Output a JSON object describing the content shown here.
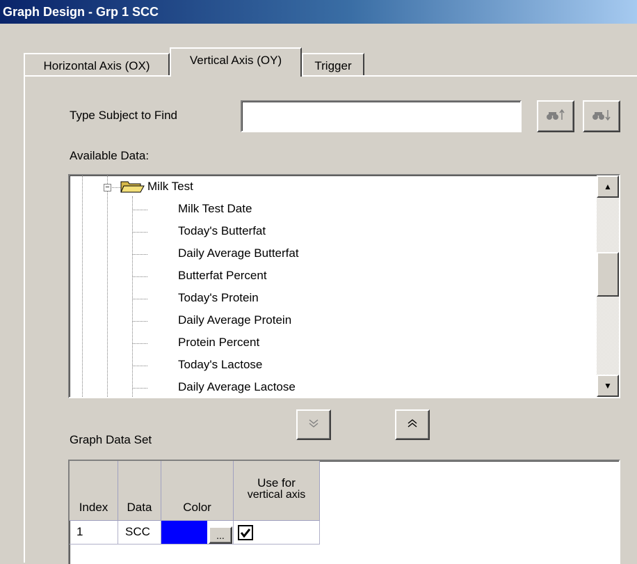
{
  "window": {
    "title": "Graph Design - Grp 1 SCC"
  },
  "tabs": [
    {
      "label": "Horizontal Axis (OX)"
    },
    {
      "label": "Vertical Axis (OY)"
    },
    {
      "label": "Trigger"
    }
  ],
  "search": {
    "label": "Type Subject to Find",
    "value": "",
    "find_up_icon": "binoculars-up-icon",
    "find_down_icon": "binoculars-down-icon"
  },
  "available_data": {
    "label": "Available Data:",
    "folder": {
      "label": "Milk Test",
      "expanded": true,
      "icon": "open-folder-icon"
    },
    "items": [
      {
        "label": "Milk Test Date"
      },
      {
        "label": "Today's Butterfat"
      },
      {
        "label": "Daily Average Butterfat"
      },
      {
        "label": "Butterfat Percent"
      },
      {
        "label": "Today's Protein"
      },
      {
        "label": "Daily Average Protein"
      },
      {
        "label": "Protein Percent"
      },
      {
        "label": "Today's Lactose"
      },
      {
        "label": "Daily Average Lactose"
      }
    ]
  },
  "move_buttons": {
    "add_icon": "double-chevron-down-icon",
    "remove_icon": "double-chevron-up-icon"
  },
  "graph_data_set": {
    "label": "Graph Data Set",
    "columns": {
      "index": "Index",
      "data": "Data",
      "color": "Color",
      "use_line1": "Use for",
      "use_line2": "vertical axis"
    },
    "rows": [
      {
        "index": "1",
        "data": "SCC",
        "color": "#0000ff",
        "color_button": "...",
        "use_for_vertical_axis": true
      }
    ]
  },
  "colors": {
    "title_bar": "#0a246a",
    "face": "#d4d0c8",
    "series_color": "#0000ff"
  }
}
